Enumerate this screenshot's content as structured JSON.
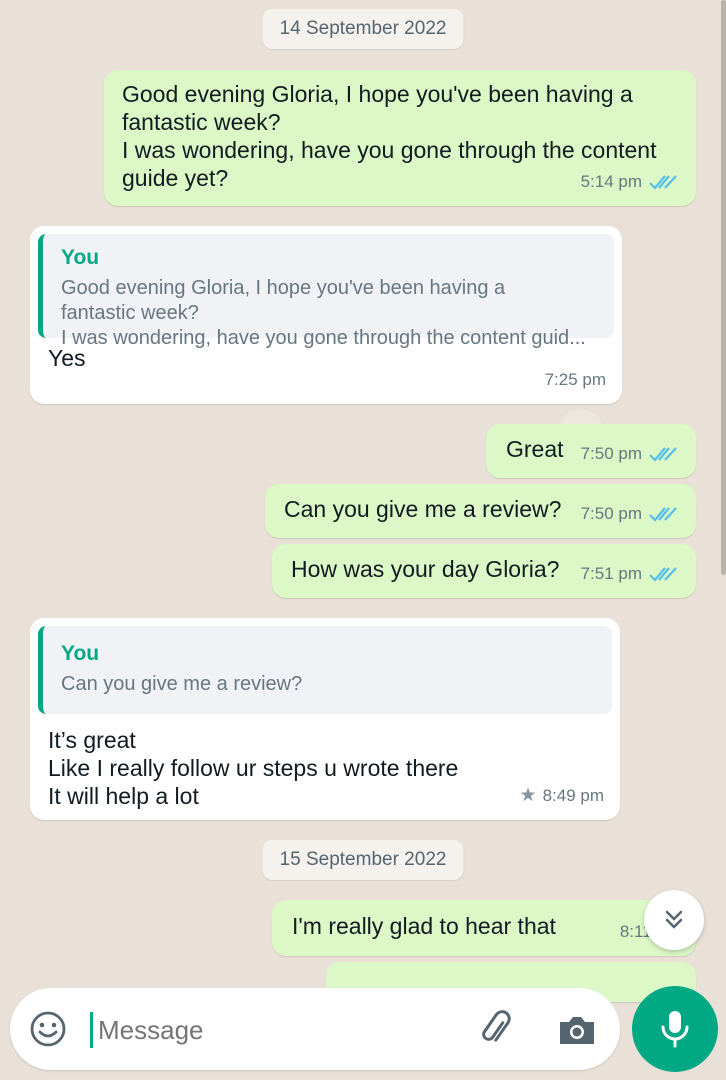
{
  "dates": [
    "14 September 2022",
    "15 September 2022"
  ],
  "messages": {
    "m1": {
      "text": "Good  evening Gloria, I hope you've been having a\nfantastic week?\nI was wondering, have you gone through the content\nguide yet?",
      "time": "5:14 pm"
    },
    "m2": {
      "quote_author": "You",
      "quote_text": "Good  evening Gloria, I hope you've been having a\nfantastic week?\nI was wondering, have you gone through the content guid...",
      "text": "Yes",
      "time": "7:25 pm"
    },
    "m3": {
      "text": "Great",
      "time": "7:50 pm"
    },
    "m4": {
      "text": "Can you give me a review?",
      "time": "7:50 pm"
    },
    "m5": {
      "text": "How was your day Gloria?",
      "time": "7:51 pm"
    },
    "m6": {
      "quote_author": "You",
      "quote_text": "Can you give me a review?",
      "text": "It’s great\nLike I  really follow ur steps u wrote there\nIt will help a lot",
      "time": "8:49 pm"
    },
    "m7": {
      "text": "I'm really glad to hear that",
      "time": "8:11 am"
    }
  },
  "input": {
    "placeholder": "Message"
  },
  "icons": {
    "emoji": "emoji-icon",
    "attach": "paperclip-icon",
    "camera": "camera-icon",
    "mic": "microphone-icon",
    "scroll": "chevron-double-down-icon",
    "read": "double-check-icon",
    "star": "star-icon"
  },
  "colors": {
    "outgoing": "#dcf8c6",
    "incoming": "#ffffff",
    "accent": "#00a884",
    "read_ticks": "#53bdeb"
  }
}
